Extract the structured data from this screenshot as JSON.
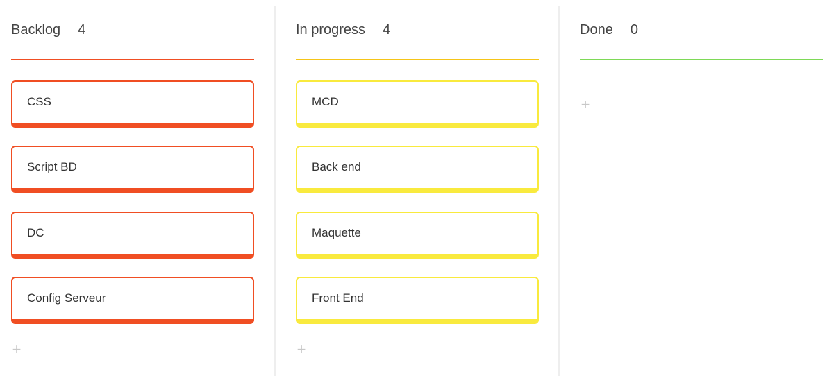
{
  "colors": {
    "backlog": "#f04e23",
    "in_progress_line": "#f5c518",
    "in_progress_card": "#f9ea3e",
    "done": "#7ed957"
  },
  "columns": [
    {
      "title": "Backlog",
      "count": "4",
      "cards": [
        "CSS",
        "Script BD",
        "DC",
        "Config Serveur"
      ],
      "add_icon": "+"
    },
    {
      "title": "In progress",
      "count": "4",
      "cards": [
        "MCD",
        "Back end",
        "Maquette",
        "Front End"
      ],
      "add_icon": "+"
    },
    {
      "title": "Done",
      "count": "0",
      "cards": [],
      "add_icon": "+"
    }
  ]
}
